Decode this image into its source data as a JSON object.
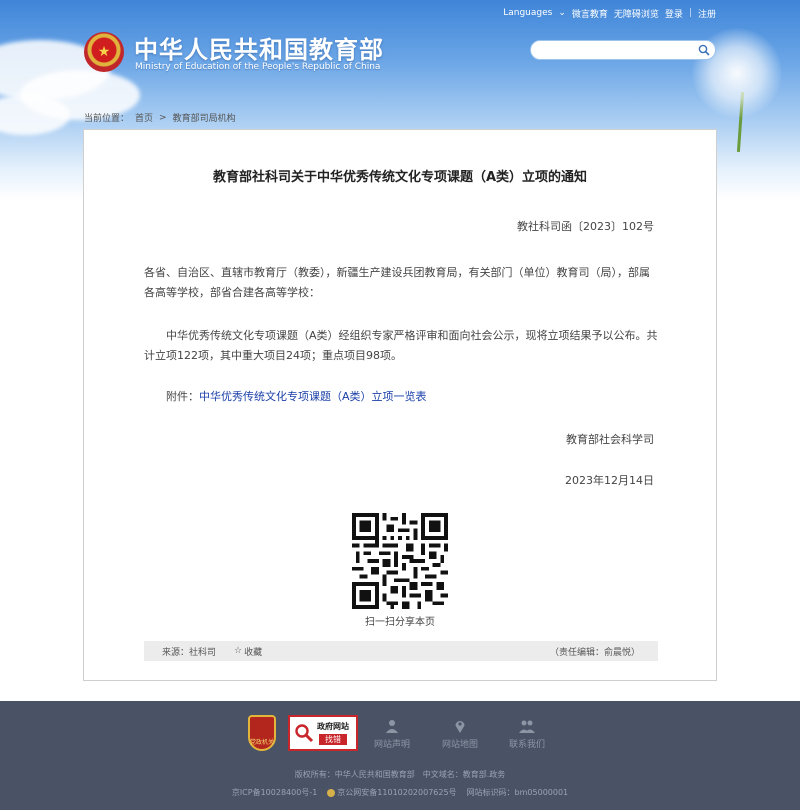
{
  "header": {
    "top_links": [
      "Languages",
      "微言教育",
      "无障碍浏览",
      "登录",
      "注册"
    ],
    "title": "中华人民共和国教育部",
    "subtitle": "Ministry of Education of the People's Republic of China",
    "search_placeholder": ""
  },
  "breadcrumb": {
    "prefix": "当前位置：",
    "home": "首页",
    "separator": ">",
    "current": "教育部司局机构"
  },
  "article": {
    "title": "教育部社科司关于中华优秀传统文化专项课题（A类）立项的通知",
    "doc_number": "教社科司函〔2023〕102号",
    "para1": "各省、自治区、直辖市教育厅（教委），新疆生产建设兵团教育局，有关部门（单位）教育司（局），部属各高等学校，部省合建各高等学校：",
    "para2": "中华优秀传统文化专项课题（A类）经组织专家严格评审和面向社会公示，现将立项结果予以公布。共计立项122项，其中重大项目24项；重点项目98项。",
    "attachment_label": "附件：",
    "attachment_link": "中华优秀传统文化专项课题（A类）立项一览表",
    "signature": "教育部社会科学司",
    "date": "2023年12月14日",
    "qr_caption": "扫一扫分享本页",
    "source": "来源：社科司",
    "favorite": "收藏",
    "editor": "（责任编辑：俞晨悦）"
  },
  "footer": {
    "badge_gov": "党政机关",
    "find_title": "政府网站",
    "find_sub": "找错",
    "links": [
      "网站声明",
      "网站地图",
      "联系我们"
    ],
    "copyright": "版权所有：中华人民共和国教育部　中文域名：教育部.政务",
    "icp": "京ICP备10028400号-1",
    "police": "京公网安备11010202007625号",
    "site_code": "网站标识码：bm05000001"
  },
  "colors": {
    "footer_bg": "#4a5366",
    "link_blue": "#1a3fa8",
    "accent_red": "#c9262b"
  }
}
